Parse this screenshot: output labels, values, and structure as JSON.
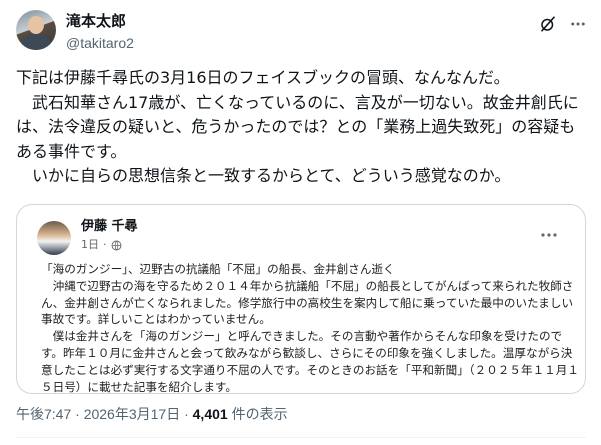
{
  "author": {
    "name": "滝本太郎",
    "handle": "@takitaro2"
  },
  "tweet": {
    "lines": [
      "下記は伊藤千尋氏の3月16日のフェイスブックの冒頭、なんなんだ。",
      "　武石知華さん17歳が、亡くなっているのに、言及が一切ない。故金井創氏には、法令違反の疑いと、危うかったのでは？との「業務上過失致死」の容疑もある事件です。",
      "　いかに自らの思想信条と一致するからとて、どういう感覚なのか。"
    ]
  },
  "embedded_post": {
    "author_name": "伊藤 千尋",
    "time": "1日",
    "paragraphs": [
      "「海のガンジー」、辺野古の抗議船「不屈」の船長、金井創さん逝く",
      "　沖縄で辺野古の海を守るため２０１４年から抗議船「不屈」の船長としてがんばって来られた牧師さん、金井創さんが亡くなられました。修学旅行中の高校生を案内して船に乗っていた最中のいたましい事故です。詳しいことはわかっていません。",
      "　僕は金井さんを「海のガンジー」と呼んできました。その言動や著作からそんな印象を受けたのです。昨年１０月に金井さんと会って飲みながら歓談し、さらにその印象を強くしました。温厚ながら決意したことは必ず実行する文字通り不屈の人です。そのときのお話を「平和新聞」（２０２５年１１月１５日号）に載せた記事を紹介します。"
    ]
  },
  "footer": {
    "timestamp": "午後7:47 · 2026年3月17日 · ",
    "views": "4,401",
    "views_label": " 件の表示"
  },
  "icons": {
    "grok": "grok-icon",
    "more": "more-icon",
    "globe": "globe-icon"
  }
}
